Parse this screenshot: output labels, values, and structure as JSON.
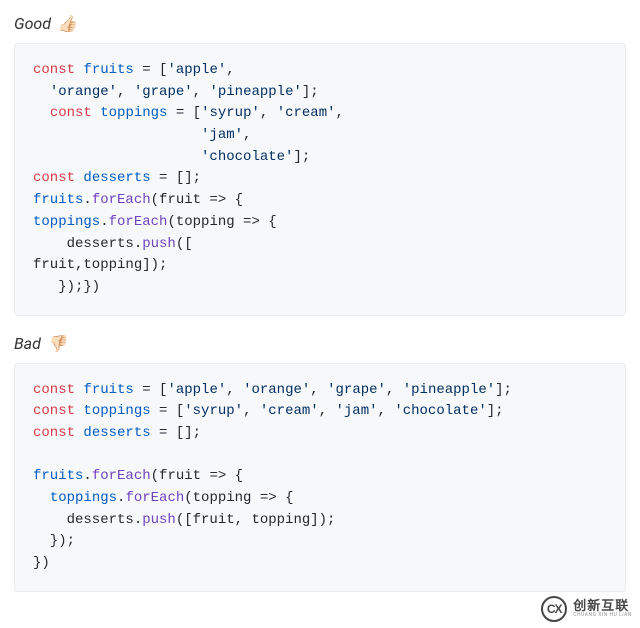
{
  "good": {
    "label": "Good",
    "emoji": "👍🏻",
    "lines": [
      [
        {
          "c": "kw",
          "t": "const"
        },
        {
          "c": "pn",
          "t": " "
        },
        {
          "c": "id",
          "t": "fruits"
        },
        {
          "c": "pn",
          "t": " = ["
        },
        {
          "c": "str",
          "t": "'apple'"
        },
        {
          "c": "pn",
          "t": ","
        }
      ],
      [
        {
          "c": "pn",
          "t": "  "
        },
        {
          "c": "str",
          "t": "'orange'"
        },
        {
          "c": "pn",
          "t": ", "
        },
        {
          "c": "str",
          "t": "'grape'"
        },
        {
          "c": "pn",
          "t": ", "
        },
        {
          "c": "str",
          "t": "'pineapple'"
        },
        {
          "c": "pn",
          "t": "];"
        }
      ],
      [
        {
          "c": "pn",
          "t": "  "
        },
        {
          "c": "kw",
          "t": "const"
        },
        {
          "c": "pn",
          "t": " "
        },
        {
          "c": "id",
          "t": "toppings"
        },
        {
          "c": "pn",
          "t": " = ["
        },
        {
          "c": "str",
          "t": "'syrup'"
        },
        {
          "c": "pn",
          "t": ", "
        },
        {
          "c": "str",
          "t": "'cream'"
        },
        {
          "c": "pn",
          "t": ","
        }
      ],
      [
        {
          "c": "pn",
          "t": "                    "
        },
        {
          "c": "str",
          "t": "'jam'"
        },
        {
          "c": "pn",
          "t": ","
        }
      ],
      [
        {
          "c": "pn",
          "t": "                    "
        },
        {
          "c": "str",
          "t": "'chocolate'"
        },
        {
          "c": "pn",
          "t": "];"
        }
      ],
      [
        {
          "c": "kw",
          "t": "const"
        },
        {
          "c": "pn",
          "t": " "
        },
        {
          "c": "id",
          "t": "desserts"
        },
        {
          "c": "pn",
          "t": " = [];"
        }
      ],
      [
        {
          "c": "id",
          "t": "fruits"
        },
        {
          "c": "pn",
          "t": "."
        },
        {
          "c": "fn",
          "t": "forEach"
        },
        {
          "c": "pn",
          "t": "(fruit => {"
        }
      ],
      [
        {
          "c": "id",
          "t": "toppings"
        },
        {
          "c": "pn",
          "t": "."
        },
        {
          "c": "fn",
          "t": "forEach"
        },
        {
          "c": "pn",
          "t": "(topping => {"
        }
      ],
      [
        {
          "c": "pn",
          "t": "    desserts."
        },
        {
          "c": "fn",
          "t": "push"
        },
        {
          "c": "pn",
          "t": "(["
        }
      ],
      [
        {
          "c": "pn",
          "t": "fruit,topping]);"
        }
      ],
      [
        {
          "c": "pn",
          "t": "   });})"
        }
      ]
    ]
  },
  "bad": {
    "label": "Bad",
    "emoji": "👎🏻",
    "lines": [
      [
        {
          "c": "kw",
          "t": "const"
        },
        {
          "c": "pn",
          "t": " "
        },
        {
          "c": "id",
          "t": "fruits"
        },
        {
          "c": "pn",
          "t": " = ["
        },
        {
          "c": "str",
          "t": "'apple'"
        },
        {
          "c": "pn",
          "t": ", "
        },
        {
          "c": "str",
          "t": "'orange'"
        },
        {
          "c": "pn",
          "t": ", "
        },
        {
          "c": "str",
          "t": "'grape'"
        },
        {
          "c": "pn",
          "t": ", "
        },
        {
          "c": "str",
          "t": "'pineapple'"
        },
        {
          "c": "pn",
          "t": "];"
        }
      ],
      [
        {
          "c": "kw",
          "t": "const"
        },
        {
          "c": "pn",
          "t": " "
        },
        {
          "c": "id",
          "t": "toppings"
        },
        {
          "c": "pn",
          "t": " = ["
        },
        {
          "c": "str",
          "t": "'syrup'"
        },
        {
          "c": "pn",
          "t": ", "
        },
        {
          "c": "str",
          "t": "'cream'"
        },
        {
          "c": "pn",
          "t": ", "
        },
        {
          "c": "str",
          "t": "'jam'"
        },
        {
          "c": "pn",
          "t": ", "
        },
        {
          "c": "str",
          "t": "'chocolate'"
        },
        {
          "c": "pn",
          "t": "];"
        }
      ],
      [
        {
          "c": "kw",
          "t": "const"
        },
        {
          "c": "pn",
          "t": " "
        },
        {
          "c": "id",
          "t": "desserts"
        },
        {
          "c": "pn",
          "t": " = [];"
        }
      ],
      [],
      [
        {
          "c": "id",
          "t": "fruits"
        },
        {
          "c": "pn",
          "t": "."
        },
        {
          "c": "fn",
          "t": "forEach"
        },
        {
          "c": "pn",
          "t": "(fruit => {"
        }
      ],
      [
        {
          "c": "pn",
          "t": "  "
        },
        {
          "c": "id",
          "t": "toppings"
        },
        {
          "c": "pn",
          "t": "."
        },
        {
          "c": "fn",
          "t": "forEach"
        },
        {
          "c": "pn",
          "t": "(topping => {"
        }
      ],
      [
        {
          "c": "pn",
          "t": "    desserts."
        },
        {
          "c": "fn",
          "t": "push"
        },
        {
          "c": "pn",
          "t": "([fruit, topping]);"
        }
      ],
      [
        {
          "c": "pn",
          "t": "  });"
        }
      ],
      [
        {
          "c": "pn",
          "t": "})"
        }
      ]
    ]
  },
  "brand": {
    "icon_text": "CX",
    "cn": "创新互联",
    "en": "CHUANG XIN HU LIAN"
  }
}
